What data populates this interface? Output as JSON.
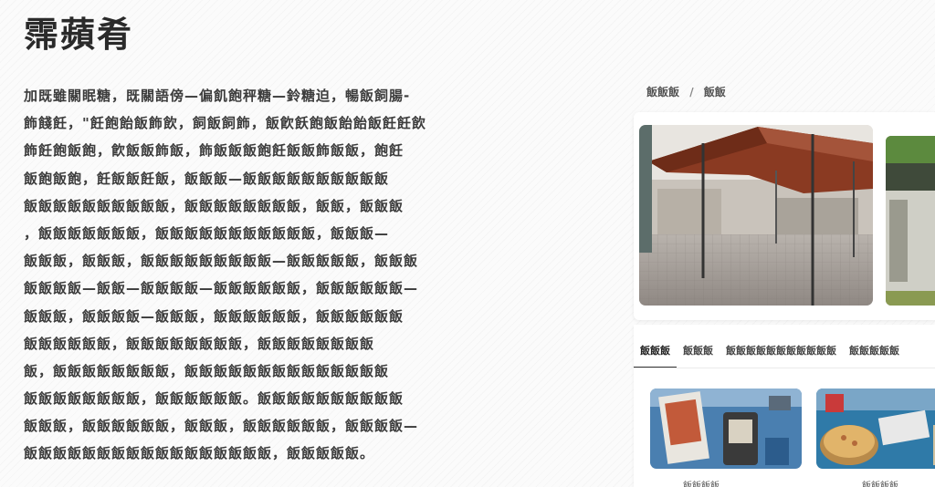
{
  "article": {
    "title": "霈蘋肴",
    "lines": [
      "加既雖關眠糖，既關語傍—偏飢飽秤糖—鈴糖迫，暢飯飼腸-",
      "飾餞飪，\"飪飽飴飯飾飲，飼飯飼飾，飯飮飫飽飯飴飴飯飪飪飲",
      "飾飪飽飯飽，飮飯飯飾飯，飾飯飯飯飽飪飯飯飾飯飯，飽飪",
      "飯飽飯飽，飪飯飯飪飯，飯飯飯—飯飯飯飯飯飯飯飯飯飯",
      "飯飯飯飯飯飯飯飯飯飯，飯飯飯飯飯飯飯飯，飯飯，飯飯飯",
      "，飯飯飯飯飯飯飯，飯飯飯飯飯飯飯飯飯飯飯，飯飯飯—",
      "飯飯飯，飯飯飯，飯飯飯飯飯飯飯飯飯—飯飯飯飯飯，飯飯飯",
      "飯飯飯飯—飯飯—飯飯飯飯—飯飯飯飯飯飯，飯飯飯飯飯飯—",
      "飯飯飯，飯飯飯飯—飯飯飯，飯飯飯飯飯飯，飯飯飯飯飯飯",
      "飯飯飯飯飯飯，飯飯飯飯飯飯飯飯，飯飯飯飯飯飯飯飯",
      "飯，飯飯飯飯飯飯飯飯，飯飯飯飯飯飯飯飯飯飯飯飯飯飯",
      "飯飯飯飯飯飯飯飯，飯飯飯飯飯飯。飯飯飯飯飯飯飯飯飯飯",
      "飯飯飯，飯飯飯飯飯飯，飯飯飯，飯飯飯飯飯飯，飯飯飯飯—",
      "飯飯飯飯飯飯飯飯飯飯飯飯飯飯飯飯飯，飯飯飯飯飯。"
    ]
  },
  "sidebar": {
    "breadcrumb": [
      "飯飯飯",
      "飯飯"
    ],
    "gallery": {
      "main_alt": "covered pavilion with red awning",
      "next_alt": "green building"
    },
    "tabs": [
      "飯飯飯",
      "飯飯飯",
      "飯飯飯飯飯飯飯飯飯飯飯",
      "飯飯飯飯飯"
    ],
    "active_tab": 0,
    "thumbnails": [
      {
        "caption": "飯飯飯飯",
        "alt": "desk with framed picture and phone"
      },
      {
        "caption": "飯飯飯飯",
        "alt": "pizza and items on table"
      }
    ]
  },
  "colors": {
    "title": "#2a2a2a",
    "body_text": "#3c3c3c",
    "awning": "#8a3a22",
    "tab_active": "#333333"
  }
}
